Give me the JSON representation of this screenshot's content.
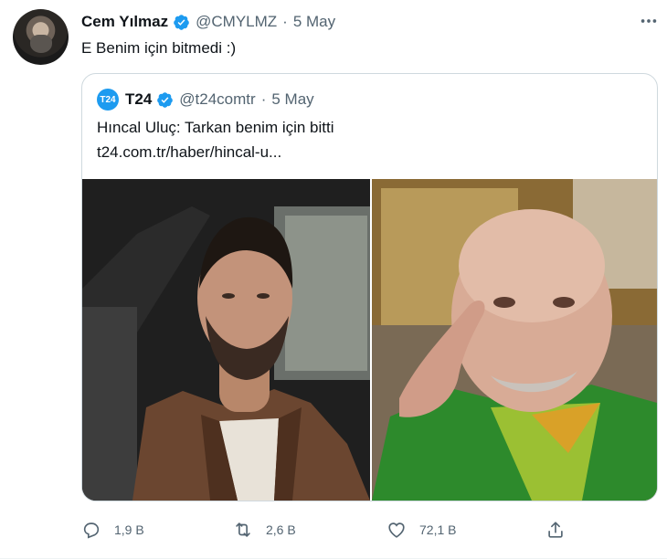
{
  "author": {
    "name": "Cem Yılmaz",
    "handle": "@CMYLMZ",
    "separator": "·",
    "date": "5 May",
    "verified": true
  },
  "tweet_text": "E Benim için bitmedi :)",
  "quoted": {
    "logo_text": "T24",
    "name": "T24",
    "handle": "@t24comtr",
    "separator": "·",
    "date": "5 May",
    "verified": true,
    "title": "Hıncal Uluç: Tarkan benim için bitti",
    "link": "t24.com.tr/haber/hincal-u..."
  },
  "actions": {
    "reply": {
      "icon": "reply-icon",
      "count": "1,9 B"
    },
    "retweet": {
      "icon": "retweet-icon",
      "count": "2,6 B"
    },
    "like": {
      "icon": "like-icon",
      "count": "72,1 B"
    },
    "share": {
      "icon": "share-icon"
    }
  },
  "colors": {
    "verified": "#1d9bf0",
    "muted": "#536471",
    "border": "#cfd9de"
  }
}
